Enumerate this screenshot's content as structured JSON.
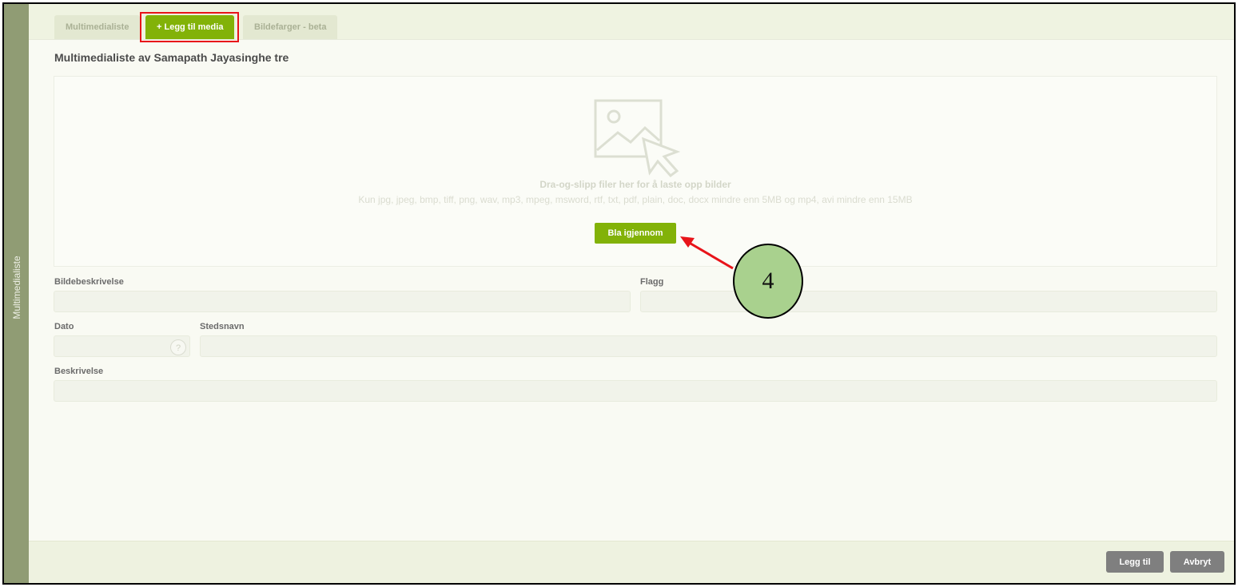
{
  "sidebar": {
    "label": "Multimedialiste"
  },
  "tabs": [
    {
      "label": "Multimedialiste"
    },
    {
      "label": "+ Legg til media"
    },
    {
      "label": "Bildefarger - beta"
    }
  ],
  "page": {
    "title": "Multimedialiste av Samapath Jayasinghe tre"
  },
  "dropzone": {
    "title": "Dra-og-slipp filer her for å laste opp bilder",
    "subtitle": "Kun jpg, jpeg, bmp, tiff, png, wav, mp3, mpeg, msword, rtf, txt, pdf, plain, doc, docx mindre enn 5MB og mp4, avi mindre enn 15MB",
    "browse_label": "Bla igjennom"
  },
  "form": {
    "description_label": "Bildebeskrivelse",
    "flag_label": "Flagg",
    "date_label": "Dato",
    "place_label": "Stedsnavn",
    "long_description_label": "Beskrivelse",
    "date_help": "?"
  },
  "footer": {
    "add_label": "Legg til",
    "cancel_label": "Avbryt"
  },
  "annotation": {
    "step_number": "4",
    "accent_color": "#e8141a",
    "badge_color": "#a9d18e"
  }
}
